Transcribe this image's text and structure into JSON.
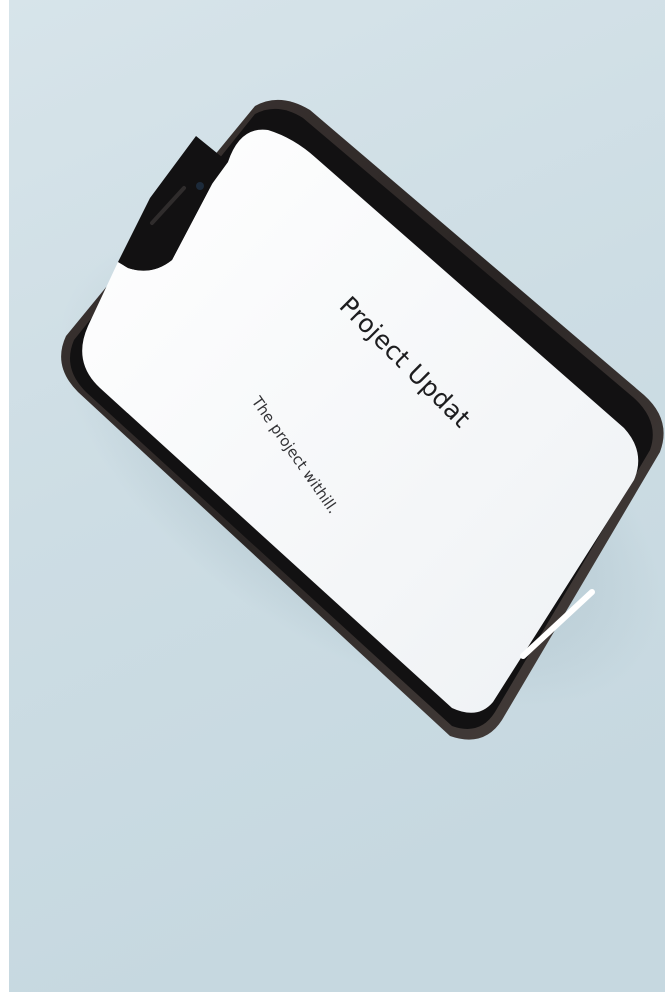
{
  "screen": {
    "title": "Project Updat",
    "message": "The project withill."
  },
  "colors": {
    "background": "#cfdfe6",
    "phone_frame": "#1b1a1b",
    "screen": "#f6f7f9"
  }
}
